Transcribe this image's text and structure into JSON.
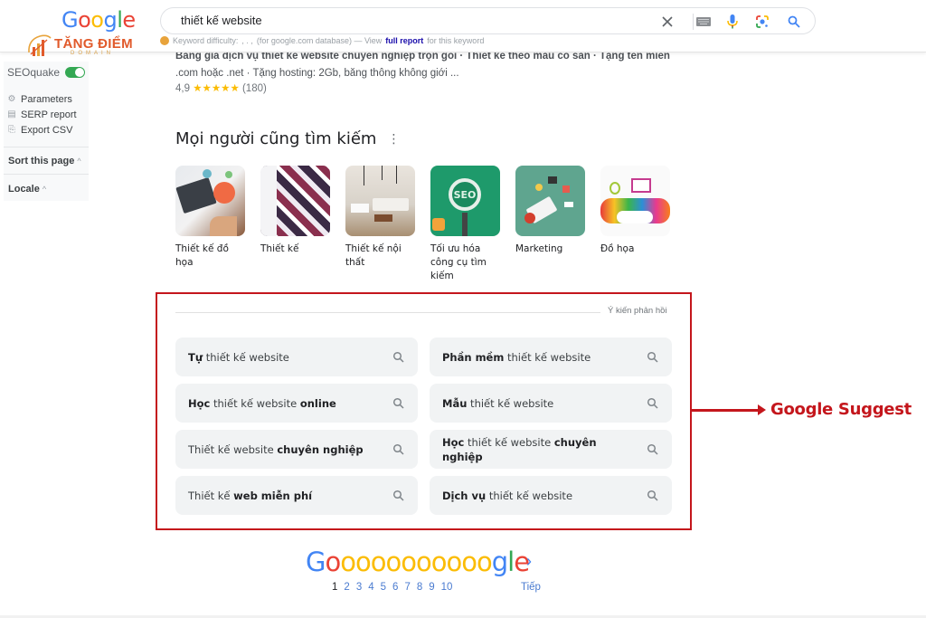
{
  "header": {
    "logo_letters": [
      {
        "ch": "G",
        "color": "blue"
      },
      {
        "ch": "o",
        "color": "red"
      },
      {
        "ch": "o",
        "color": "yellow"
      },
      {
        "ch": "g",
        "color": "blue"
      },
      {
        "ch": "l",
        "color": "green"
      },
      {
        "ch": "e",
        "color": "red"
      }
    ],
    "search": {
      "value": "thiết kế website",
      "icons": [
        "clear-icon",
        "keyboard-icon",
        "microphone-icon",
        "google-lens-icon",
        "search-icon"
      ]
    },
    "keyword_difficulty": {
      "prefix": "Keyword difficulty:",
      "value": ", . ,",
      "middle": "(for google.com database) — View",
      "link": "full report",
      "suffix": "for this keyword"
    }
  },
  "brand": {
    "name": "TĂNG ĐIỂM",
    "sub": "DOMAIN"
  },
  "seoquake": {
    "title": "SEOquake",
    "enabled": true,
    "menu": [
      {
        "label": "Parameters",
        "icon": "gear-icon"
      },
      {
        "label": "SERP report",
        "icon": "report-icon"
      },
      {
        "label": "Export CSV",
        "icon": "export-icon"
      }
    ],
    "sections": [
      "Sort this page",
      "Locale"
    ]
  },
  "result": {
    "snippet_line1": "Bảng giá dịch vụ thiết kế website chuyên nghiệp trọn gói · Thiết kế theo mẫu có sẵn · Tặng tên miền",
    "snippet_line2": ".com hoặc .net · Tặng hosting: 2Gb, băng thông không giới ...",
    "rating_value": "4,9",
    "stars": "★★★★★",
    "rating_count": "(180)"
  },
  "people_also_search": {
    "title": "Mọi người cũng tìm kiếm",
    "items": [
      {
        "label": "Thiết kế đồ họa"
      },
      {
        "label": "Thiết kế"
      },
      {
        "label": "Thiết kế nội thất"
      },
      {
        "label": "Tối ưu hóa công cụ tìm kiếm"
      },
      {
        "label": "Marketing"
      },
      {
        "label": "Đồ họa"
      }
    ]
  },
  "related_searches": {
    "feedback": "Ý kiến phản hồi",
    "items": [
      {
        "parts": [
          {
            "t": "Tự",
            "b": true
          },
          {
            "t": " thiết kế website",
            "b": false
          }
        ]
      },
      {
        "parts": [
          {
            "t": "Phần mềm",
            "b": true
          },
          {
            "t": " thiết kế website",
            "b": false
          }
        ]
      },
      {
        "parts": [
          {
            "t": "Học",
            "b": true
          },
          {
            "t": " thiết kế website ",
            "b": false
          },
          {
            "t": "online",
            "b": true
          }
        ]
      },
      {
        "parts": [
          {
            "t": "Mẫu",
            "b": true
          },
          {
            "t": " thiết kế website",
            "b": false
          }
        ]
      },
      {
        "parts": [
          {
            "t": "Thiết kế website ",
            "b": false
          },
          {
            "t": "chuyên nghiệp",
            "b": true
          }
        ]
      },
      {
        "parts": [
          {
            "t": "Học",
            "b": true
          },
          {
            "t": " thiết kế website ",
            "b": false
          },
          {
            "t": "chuyên nghiệp",
            "b": true
          }
        ]
      },
      {
        "parts": [
          {
            "t": "Thiết kế ",
            "b": false
          },
          {
            "t": "web miễn phí",
            "b": true
          }
        ]
      },
      {
        "parts": [
          {
            "t": "Dịch vụ",
            "b": true
          },
          {
            "t": " thiết kế website",
            "b": false
          }
        ]
      }
    ]
  },
  "annotation": {
    "label": "Google Suggest",
    "color": "#c4161c"
  },
  "pagination": {
    "logo_prefix": "G",
    "logo_o_first": "o",
    "logo_o_count": 10,
    "logo_suffix_g": "g",
    "logo_suffix_l": "l",
    "logo_suffix_e": "e",
    "pages": [
      "1",
      "2",
      "3",
      "4",
      "5",
      "6",
      "7",
      "8",
      "9",
      "10"
    ],
    "current": "1",
    "next_label": "Tiếp"
  },
  "colors": {
    "blue": "#4285f4",
    "red": "#ea4335",
    "yellow": "#fbbc05",
    "green": "#34a853",
    "link": "#1a0dab",
    "chip_bg": "#f1f3f4"
  }
}
